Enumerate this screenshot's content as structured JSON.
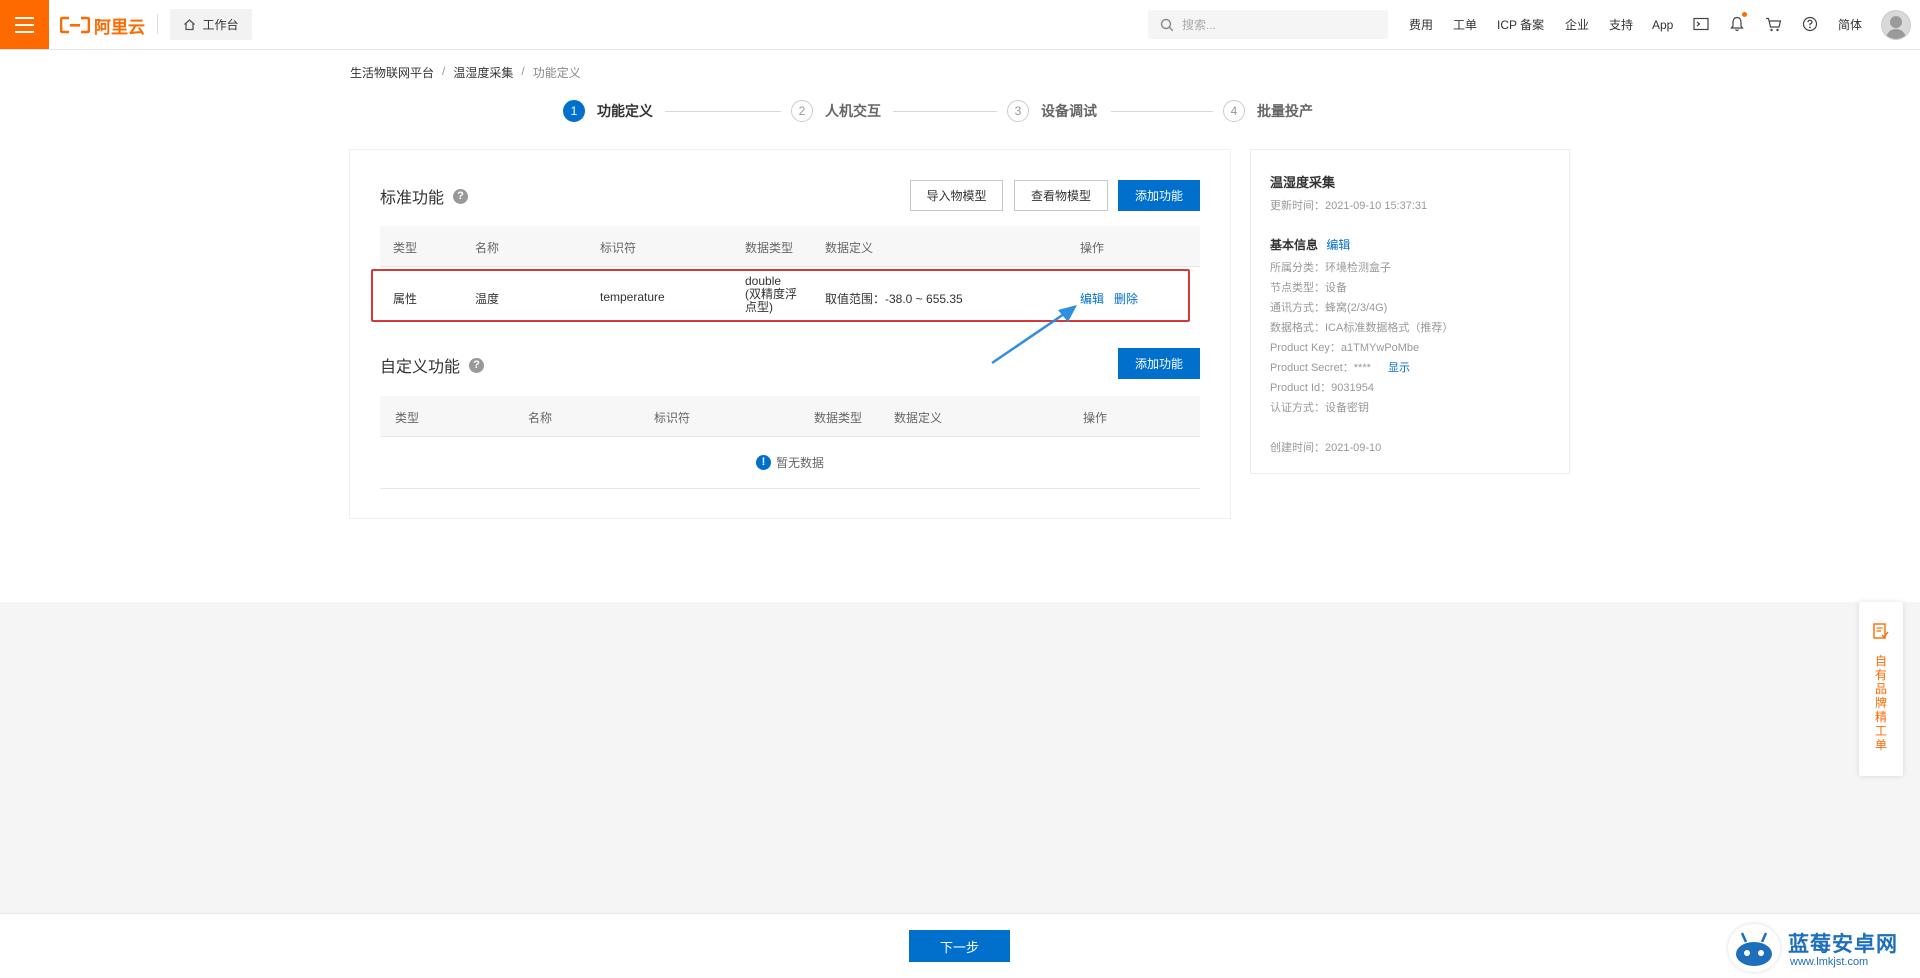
{
  "topbar": {
    "logo_text": "阿里云",
    "workbench": "工作台",
    "search_placeholder": "搜索...",
    "nav": [
      "费用",
      "工单",
      "ICP 备案",
      "企业",
      "支持",
      "App"
    ],
    "lang": "简体",
    "accent": "#ff6a00"
  },
  "breadcrumb": [
    "生活物联网平台",
    "温湿度采集",
    "功能定义"
  ],
  "steps": [
    {
      "num": "1",
      "label": "功能定义"
    },
    {
      "num": "2",
      "label": "人机交互"
    },
    {
      "num": "3",
      "label": "设备调试"
    },
    {
      "num": "4",
      "label": "批量投产"
    }
  ],
  "standard": {
    "title": "标准功能",
    "buttons": {
      "import": "导入物模型",
      "view": "查看物模型",
      "add": "添加功能"
    },
    "columns": [
      "类型",
      "名称",
      "标识符",
      "数据类型",
      "数据定义",
      "操作"
    ],
    "row": {
      "type": "属性",
      "name": "温度",
      "identifier": "temperature",
      "dtype_line1": "double",
      "dtype_line2": "(双精度浮",
      "dtype_line3": "点型)",
      "definition": "取值范围：-38.0 ~ 655.35",
      "edit": "编辑",
      "delete": "删除"
    }
  },
  "custom": {
    "title": "自定义功能",
    "add": "添加功能",
    "columns": [
      "类型",
      "名称",
      "标识符",
      "数据类型",
      "数据定义",
      "操作"
    ],
    "empty": "暂无数据"
  },
  "side": {
    "title": "温湿度采集",
    "updated": "更新时间：2021-09-10 15:37:31",
    "basic_label": "基本信息",
    "edit": "编辑",
    "lines": [
      "所属分类：环境检测盒子",
      "节点类型：设备",
      "通讯方式：蜂窝(2/3/4G)",
      "数据格式：ICA标准数据格式（推荐）",
      "Product Key：a1TMYwPoMbe",
      "Product Secret：****",
      "Product Id：9031954",
      "认证方式：设备密钥"
    ],
    "show": "显示",
    "created": "创建时间：2021-09-10"
  },
  "footer": {
    "next": "下一步"
  },
  "float_tab": {
    "text": "自有品牌精工单"
  },
  "watermark": {
    "name": "蓝莓安卓网",
    "url": "www.lmkjst.com"
  }
}
